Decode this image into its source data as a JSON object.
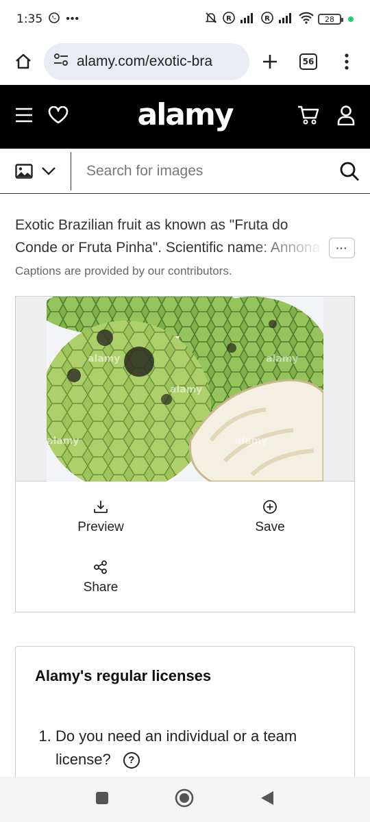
{
  "status_bar": {
    "time": "1:35",
    "battery": "28"
  },
  "browser": {
    "url": "alamy.com/exotic-bra",
    "tab_count": "56"
  },
  "site": {
    "logo": "alamy"
  },
  "search": {
    "placeholder": "Search for images"
  },
  "caption": {
    "text": "Exotic Brazilian fruit as known as \"Fruta do Conde or Fruta Pinha\". Scientific name: Annona",
    "more_label": "···",
    "note": "Captions are provided by our contributors."
  },
  "image": {
    "description": "custard apple fruits",
    "watermark": "alamy"
  },
  "actions": {
    "preview": "Preview",
    "save": "Save",
    "share": "Share"
  },
  "licenses": {
    "title": "Alamy's regular licenses",
    "question_1": "Do you need an individual or a team license?",
    "help": "?"
  },
  "colors": {
    "header_bg": "#000000",
    "url_bg": "#e9ecf3",
    "fruit_green": "#8bbf4a"
  }
}
